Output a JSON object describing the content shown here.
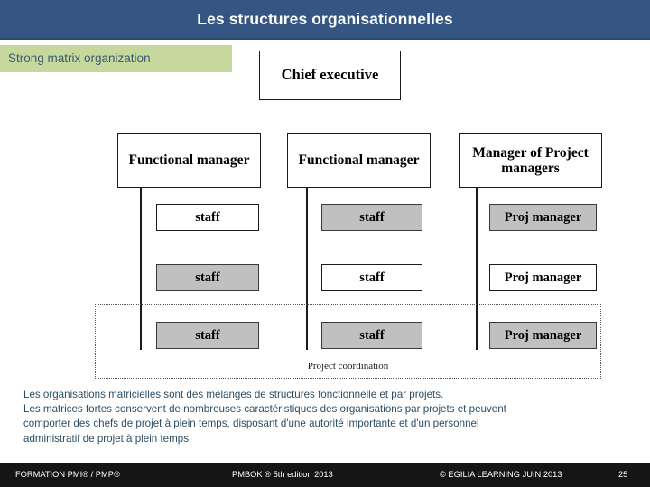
{
  "header": {
    "title": "Les structures organisationnelles",
    "bar_color": "#355682"
  },
  "section": {
    "label": "Strong matrix organization",
    "bg_color": "#c7d89b",
    "text_color": "#3b5a72"
  },
  "diagram": {
    "chief": "Chief executive",
    "managers": [
      "Functional manager",
      "Functional manager",
      "Manager of Project managers"
    ],
    "rows": [
      [
        {
          "label": "staff",
          "shaded": false
        },
        {
          "label": "staff",
          "shaded": true
        },
        {
          "label": "Proj manager",
          "shaded": true
        }
      ],
      [
        {
          "label": "staff",
          "shaded": true
        },
        {
          "label": "staff",
          "shaded": false
        },
        {
          "label": "Proj manager",
          "shaded": false
        }
      ],
      [
        {
          "label": "staff",
          "shaded": true
        },
        {
          "label": "staff",
          "shaded": true
        },
        {
          "label": "Proj manager",
          "shaded": true
        }
      ]
    ],
    "coordination_label": "Project coordination",
    "shade_color": "#c0c0c0"
  },
  "body": {
    "lines": [
      "Les organisations matricielles sont des mélanges de structures fonctionnelle et par projets.",
      "Les matrices fortes conservent de nombreuses caractéristiques des organisations par projets et peuvent",
      "comporter des chefs de projet à plein temps, disposant d'une autorité importante et d'un personnel",
      "administratif de projet à plein temps."
    ],
    "text_color": "#2e4d63"
  },
  "footer": {
    "left": "FORMATION PMI® / PMP®",
    "middle": "PMBOK ® 5th edition  2013",
    "right": "© EGILIA LEARNING  JUIN 2013",
    "page": "25",
    "bg_color": "#151515"
  }
}
